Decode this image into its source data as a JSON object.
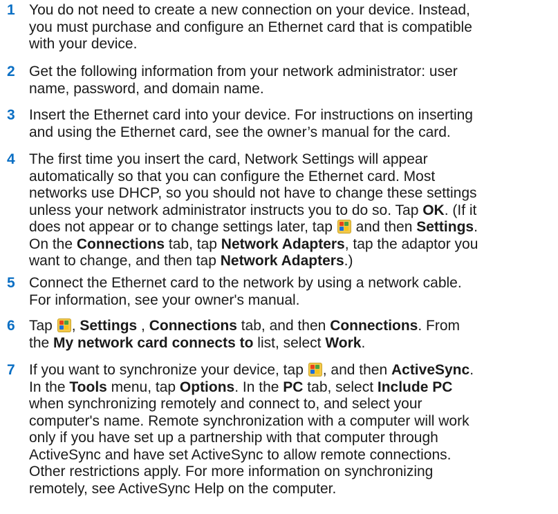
{
  "steps": [
    {
      "num": "1",
      "lines": [
        [
          {
            "t": "You do not need to create a new connection on your device. Instead,"
          }
        ],
        [
          {
            "t": "you must purchase and configure an Ethernet card that is compatible"
          }
        ],
        [
          {
            "t": "with your device."
          }
        ]
      ]
    },
    {
      "num": "2",
      "lines": [
        [
          {
            "t": "Get the following information from your network administrator: user"
          }
        ],
        [
          {
            "t": "name, password, and domain name."
          }
        ]
      ]
    },
    {
      "num": "3",
      "lines": [
        [
          {
            "t": "Insert the Ethernet card into your device. For instructions on inserting"
          }
        ],
        [
          {
            "t": "and using the Ethernet card, see the owner’s manual for the card."
          }
        ]
      ]
    },
    {
      "num": "4",
      "lines": [
        [
          {
            "t": "The first time you insert the card, Network Settings will appear"
          }
        ],
        [
          {
            "t": "automatically so that you can configure the Ethernet card. Most"
          }
        ],
        [
          {
            "t": "networks use DHCP, so you should not have to change these settings"
          }
        ],
        [
          {
            "t": "unless your network administrator instructs you to do so. Tap "
          },
          {
            "t": "OK",
            "b": true
          },
          {
            "t": ". (If it"
          }
        ],
        [
          {
            "t": "does not appear or to change settings later, tap "
          },
          {
            "icon": "start-icon"
          },
          {
            "t": " and then "
          },
          {
            "t": "Settings",
            "b": true
          },
          {
            "t": "."
          }
        ],
        [
          {
            "t": "On the "
          },
          {
            "t": "Connections",
            "b": true
          },
          {
            "t": " tab, tap "
          },
          {
            "t": "Network Adapters",
            "b": true
          },
          {
            "t": ", tap the adaptor you"
          }
        ],
        [
          {
            "t": "want to change, and then tap "
          },
          {
            "t": "Network Adapters",
            "b": true
          },
          {
            "t": ".)"
          }
        ]
      ]
    },
    {
      "num": "5",
      "lines": [
        [
          {
            "t": "Connect the Ethernet card to the network by using a network cable."
          }
        ],
        [
          {
            "t": "For information, see your owner's manual."
          }
        ]
      ]
    },
    {
      "num": "6",
      "lines": [
        [
          {
            "t": "Tap "
          },
          {
            "icon": "start-icon"
          },
          {
            "t": ", "
          },
          {
            "t": "Settings",
            "b": true
          },
          {
            "t": " , "
          },
          {
            "t": "Connections",
            "b": true
          },
          {
            "t": " tab, and then "
          },
          {
            "t": "Connections",
            "b": true
          },
          {
            "t": ". From"
          }
        ],
        [
          {
            "t": "the "
          },
          {
            "t": "My network card connects to",
            "b": true
          },
          {
            "t": " list, select "
          },
          {
            "t": "Work",
            "b": true
          },
          {
            "t": "."
          }
        ]
      ]
    },
    {
      "num": "7",
      "lines": [
        [
          {
            "t": "If you want to synchronize your device, tap "
          },
          {
            "icon": "start-icon"
          },
          {
            "t": ", and then "
          },
          {
            "t": "ActiveSync",
            "b": true
          },
          {
            "t": "."
          }
        ],
        [
          {
            "t": "In the "
          },
          {
            "t": "Tools",
            "b": true
          },
          {
            "t": " menu, tap "
          },
          {
            "t": "Options",
            "b": true
          },
          {
            "t": ". In the "
          },
          {
            "t": "PC",
            "b": true
          },
          {
            "t": " tab, select "
          },
          {
            "t": "Include PC",
            "b": true
          }
        ],
        [
          {
            "t": "when synchronizing remotely and connect to, and select your"
          }
        ],
        [
          {
            "t": "computer's name. Remote synchronization with a computer will work"
          }
        ],
        [
          {
            "t": "only if you have set up a partnership with that computer through"
          }
        ],
        [
          {
            "t": "ActiveSync and have set ActiveSync to allow remote connections."
          }
        ],
        [
          {
            "t": "Other restrictions apply. For more information on synchronizing"
          }
        ],
        [
          {
            "t": "remotely, see ActiveSync Help on the computer."
          }
        ]
      ]
    }
  ]
}
